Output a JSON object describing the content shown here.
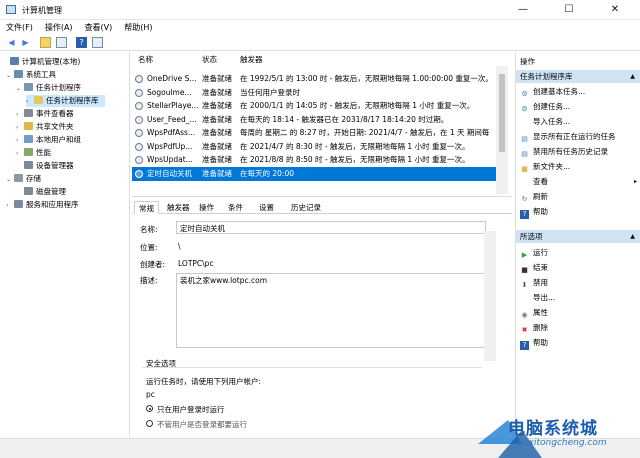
{
  "window": {
    "title": "计算机管理",
    "min": "—",
    "max": "☐",
    "close": "✕"
  },
  "menu": [
    "文件(F)",
    "操作(A)",
    "查看(V)",
    "帮助(H)"
  ],
  "tree": [
    {
      "label": "计算机管理(本地)",
      "level": 0,
      "toggle": "",
      "color": "#5b7fa8"
    },
    {
      "label": "系统工具",
      "level": 1,
      "toggle": "⌄",
      "color": "#6b8cae"
    },
    {
      "label": "任务计划程序",
      "level": 2,
      "toggle": "⌄",
      "color": "#7a96b8"
    },
    {
      "label": "任务计划程序库",
      "level": 3,
      "toggle": "›",
      "color": "#e8c65a"
    },
    {
      "label": "事件查看器",
      "level": 2,
      "toggle": "›",
      "color": "#7e8c9a"
    },
    {
      "label": "共享文件夹",
      "level": 2,
      "toggle": "›",
      "color": "#e0b84a"
    },
    {
      "label": "本地用户和组",
      "level": 2,
      "toggle": "›",
      "color": "#6f9cc9"
    },
    {
      "label": "性能",
      "level": 2,
      "toggle": "›",
      "color": "#8aa56a"
    },
    {
      "label": "设备管理器",
      "level": 2,
      "toggle": "",
      "color": "#7a8a9a"
    },
    {
      "label": "存储",
      "level": 1,
      "toggle": "⌄",
      "color": "#8c9aa8"
    },
    {
      "label": "磁盘管理",
      "level": 2,
      "toggle": "",
      "color": "#7a8a9a"
    },
    {
      "label": "服务和应用程序",
      "level": 1,
      "toggle": "›",
      "color": "#7a8aa0"
    }
  ],
  "list": {
    "headers": [
      "名称",
      "状态",
      "触发器"
    ],
    "rows": [
      {
        "name": "OneDrive S...",
        "status": "准备就绪",
        "trigger": "在 1992/5/1 的 13:00 时 - 触发后，无限期地每隔 1.00:00:00 重复一次。"
      },
      {
        "name": "Sogoulme...",
        "status": "准备就绪",
        "trigger": "当任何用户登录时"
      },
      {
        "name": "StellarPlaye...",
        "status": "准备就绪",
        "trigger": "在 2000/1/1 的 14:05 时 - 触发后，无限期地每隔 1 小时 重复一次。"
      },
      {
        "name": "User_Feed_...",
        "status": "准备就绪",
        "trigger": "在每天的 18:14 - 触发器已在 2031/8/17 18:14:20 时过期。"
      },
      {
        "name": "WpsPdfAss...",
        "status": "准备就绪",
        "trigger": "每周的 星期二 的 8:27 时，开始日期: 2021/4/7 - 触发后，在 1 天 期间每"
      },
      {
        "name": "WpsPdfUp...",
        "status": "准备就绪",
        "trigger": "在 2021/4/7 的 8:30 时 - 触发后，无限期地每隔 1 小时 重复一次。"
      },
      {
        "name": "WpsUpdat...",
        "status": "准备就绪",
        "trigger": "在 2021/8/8 的 8:50 时 - 触发后，无限期地每隔 1 小时 重复一次。"
      },
      {
        "name": "定时自动关机",
        "status": "准备就绪",
        "trigger": "在每天的 20:00"
      }
    ]
  },
  "tabs": [
    "常规",
    "触发器",
    "操作",
    "条件",
    "设置",
    "历史记录"
  ],
  "general": {
    "name_label": "名称:",
    "name_value": "定时自动关机",
    "location_label": "位置:",
    "location_value": "\\",
    "author_label": "创建者:",
    "author_value": "LOTPC\\pc",
    "desc_label": "描述:",
    "desc_value": "装机之家www.lotpc.com",
    "security_title": "安全选项",
    "run_as_text": "运行任务时，请使用下列用户帐户:",
    "user_value": "pc",
    "opt1": "只在用户登录时运行",
    "opt2": "不管用户是否登录都要运行"
  },
  "actions": {
    "title": "操作",
    "section1": "任务计划程序库",
    "items1": [
      {
        "label": "创建基本任务...",
        "icon": "create-basic-task-icon",
        "glyph": "⚙",
        "color": "#4a7fb5"
      },
      {
        "label": "创建任务...",
        "icon": "create-task-icon",
        "glyph": "⚙",
        "color": "#4a7fb5"
      },
      {
        "label": "导入任务...",
        "icon": "import-icon",
        "glyph": "",
        "color": "#ffffff"
      },
      {
        "label": "显示所有正在运行的任务",
        "icon": "running-tasks-icon",
        "glyph": "▤",
        "color": "#4a7fb5"
      },
      {
        "label": "禁用所有任务历史记录",
        "icon": "history-icon",
        "glyph": "▤",
        "color": "#4a7fb5"
      },
      {
        "label": "新文件夹...",
        "icon": "folder-icon",
        "glyph": "■",
        "color": "#e3b44a"
      },
      {
        "label": "查看",
        "icon": "view-icon",
        "glyph": "",
        "color": "#ffffff",
        "arrow": "▸"
      },
      {
        "label": "刷新",
        "icon": "refresh-icon",
        "glyph": "↻",
        "color": "#2e8b57"
      },
      {
        "label": "帮助",
        "icon": "help-icon",
        "glyph": "?",
        "color": "#2a5ea8"
      }
    ],
    "section2": "所选项",
    "items2": [
      {
        "label": "运行",
        "icon": "run-icon",
        "glyph": "▶",
        "color": "#2e9e3e"
      },
      {
        "label": "结束",
        "icon": "stop-icon",
        "glyph": "■",
        "color": "#333333"
      },
      {
        "label": "禁用",
        "icon": "disable-icon",
        "glyph": "⬇",
        "color": "#555555"
      },
      {
        "label": "导出...",
        "icon": "export-icon",
        "glyph": "",
        "color": "#ffffff"
      },
      {
        "label": "属性",
        "icon": "properties-icon",
        "glyph": "◉",
        "color": "#6a7d92"
      },
      {
        "label": "删除",
        "icon": "delete-icon",
        "glyph": "✖",
        "color": "#d22a2a"
      },
      {
        "label": "帮助",
        "icon": "help-icon",
        "glyph": "?",
        "color": "#2a5ea8"
      }
    ]
  },
  "watermark": {
    "cn": "电脑系统城",
    "url": "pcxitongcheng.com"
  }
}
